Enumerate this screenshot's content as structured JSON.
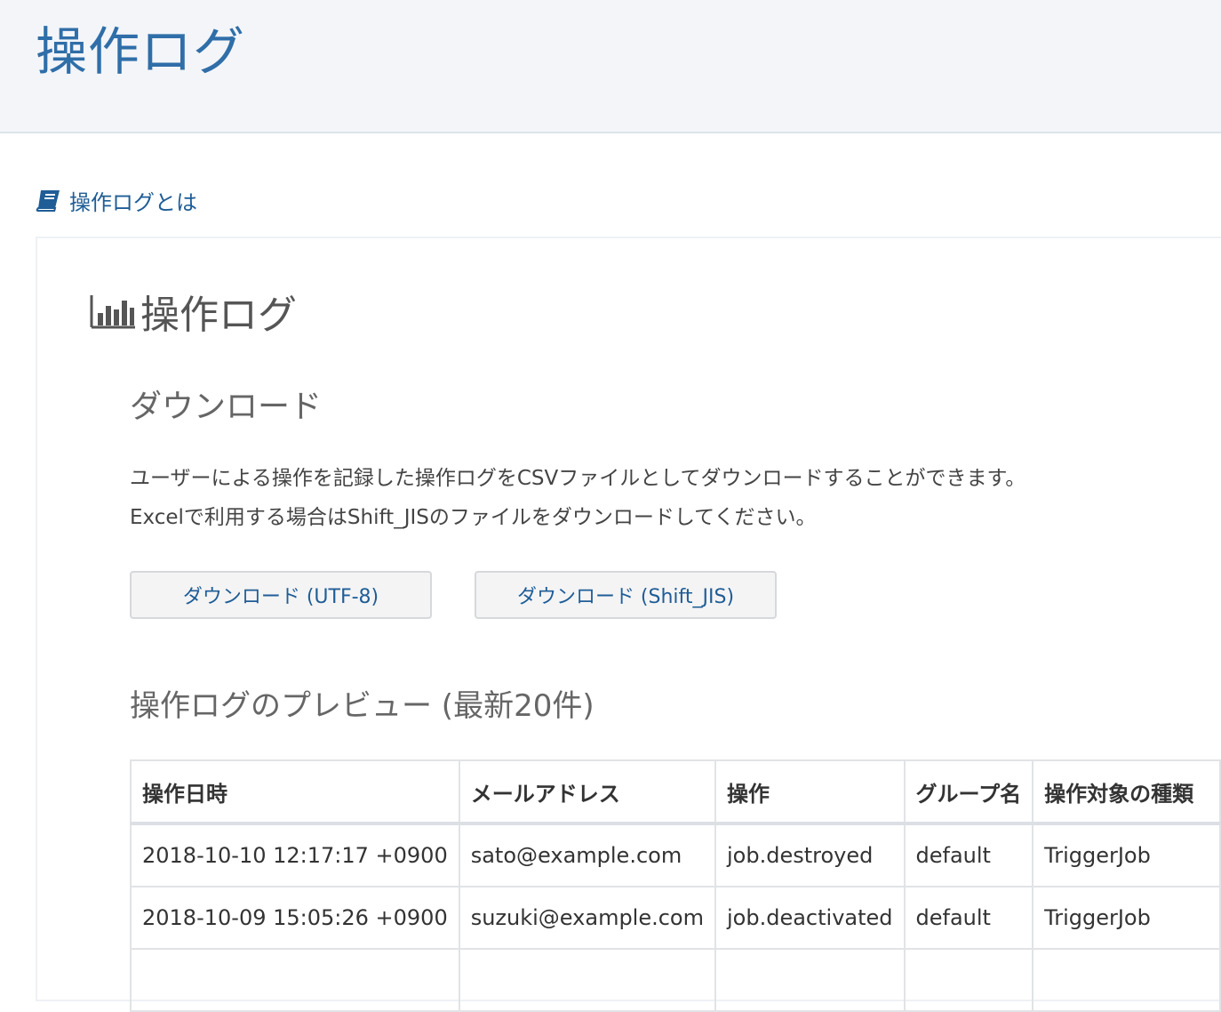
{
  "header": {
    "title": "操作ログ"
  },
  "help_link": {
    "label": "操作ログとは",
    "icon": "book-icon"
  },
  "card": {
    "title": "操作ログ",
    "icon": "bar-chart-icon"
  },
  "download": {
    "title": "ダウンロード",
    "description_lines": [
      "ユーザーによる操作を記録した操作ログをCSVファイルとしてダウンロードすることができます。",
      "Excelで利用する場合はShift_JISのファイルをダウンロードしてください。"
    ],
    "buttons": {
      "utf8": "ダウンロード (UTF-8)",
      "sjis": "ダウンロード (Shift_JIS)"
    }
  },
  "preview": {
    "title": "操作ログのプレビュー (最新20件)",
    "columns": [
      "操作日時",
      "メールアドレス",
      "操作",
      "グループ名",
      "操作対象の種類"
    ],
    "rows": [
      [
        "2018-10-10 12:17:17 +0900",
        "sato@example.com",
        "job.destroyed",
        "default",
        "TriggerJob"
      ],
      [
        "2018-10-09 15:05:26 +0900",
        "suzuki@example.com",
        "job.deactivated",
        "default",
        "TriggerJob"
      ],
      [
        "",
        "",
        "",
        "",
        ""
      ]
    ]
  },
  "colors": {
    "title_blue": "#2f6ea8",
    "link_blue": "#1f5d96",
    "header_bg": "#f3f5f9"
  }
}
